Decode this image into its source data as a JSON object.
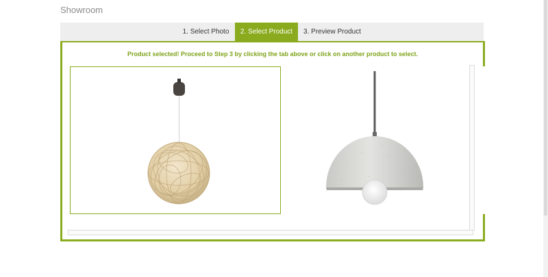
{
  "page": {
    "title": "Showroom"
  },
  "tabs": [
    {
      "label": "1. Select Photo",
      "active": false
    },
    {
      "label": "2. Select Product",
      "active": true
    },
    {
      "label": "3. Preview Product",
      "active": false
    }
  ],
  "message": "Product selected! Proceed to Step 3 by clicking the tab above or click on another product to select.",
  "colors": {
    "accent": "#8aab1e",
    "message": "#7fa31a"
  },
  "products": [
    {
      "selected": true,
      "image": "wicker-ball-pendant-lamp"
    },
    {
      "selected": false,
      "image": "concrete-dome-pendant-lamp"
    }
  ]
}
